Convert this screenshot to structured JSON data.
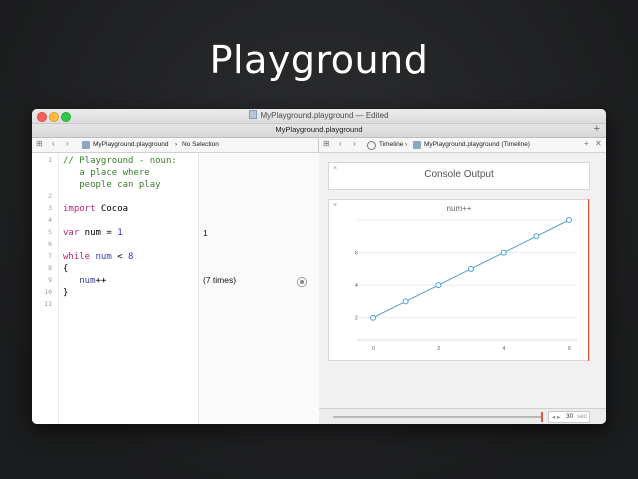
{
  "slide": {
    "title": "Playground"
  },
  "window": {
    "title": "MyPlayground.playground — Edited",
    "tab_label": "MyPlayground.playground",
    "tab_add": "+"
  },
  "editor_jumpbar": {
    "grid_icon": "⊞",
    "back_icon": "‹",
    "forward_icon": "›",
    "file": "MyPlayground.playground",
    "sep": "›",
    "selection": "No Selection"
  },
  "assistant_jumpbar": {
    "grid_icon": "⊞",
    "back_icon": "‹",
    "forward_icon": "›",
    "mode": "Timeline",
    "sep": "›",
    "file": "MyPlayground.playground (Timeline)",
    "add_icon": "+",
    "close_icon": "✕"
  },
  "code": {
    "line_numbers": [
      "1",
      "",
      "",
      "2",
      "3",
      "4",
      "5",
      "6",
      "7",
      "8",
      "9",
      "10",
      "11"
    ],
    "lines": [
      {
        "segments": [
          {
            "t": "// Playground - noun:",
            "c": "cmt"
          }
        ]
      },
      {
        "segments": [
          {
            "t": "   a place where",
            "c": "cmt"
          }
        ]
      },
      {
        "segments": [
          {
            "t": "   people can play",
            "c": "cmt"
          }
        ]
      },
      {
        "segments": []
      },
      {
        "segments": [
          {
            "t": "import",
            "c": "kw"
          },
          {
            "t": " Cocoa",
            "c": ""
          }
        ]
      },
      {
        "segments": []
      },
      {
        "segments": [
          {
            "t": "var",
            "c": "kw"
          },
          {
            "t": " num = ",
            "c": ""
          },
          {
            "t": "1",
            "c": "num"
          }
        ]
      },
      {
        "segments": []
      },
      {
        "segments": [
          {
            "t": "while",
            "c": "kw"
          },
          {
            "t": " ",
            "c": ""
          },
          {
            "t": "num",
            "c": "var"
          },
          {
            "t": " < ",
            "c": ""
          },
          {
            "t": "8",
            "c": "num"
          }
        ]
      },
      {
        "segments": [
          {
            "t": "{",
            "c": ""
          }
        ]
      },
      {
        "segments": [
          {
            "t": "   ",
            "c": ""
          },
          {
            "t": "num",
            "c": "var"
          },
          {
            "t": "++",
            "c": ""
          }
        ]
      },
      {
        "segments": [
          {
            "t": "}",
            "c": ""
          }
        ]
      }
    ]
  },
  "results": {
    "var_result": "1",
    "loop_result": "(7 times)"
  },
  "timeline": {
    "console": {
      "title": "Console Output",
      "close": "×"
    },
    "graph": {
      "close": "×",
      "title": "num++"
    }
  },
  "chart_data": {
    "type": "line",
    "title": "num++",
    "x": [
      0,
      1,
      2,
      3,
      4,
      5,
      6
    ],
    "series": [
      {
        "values": [
          2,
          3,
          4,
          5,
          6,
          7,
          8
        ]
      }
    ],
    "x_ticks": [
      "0",
      "2",
      "4",
      "6"
    ],
    "y_ticks": [
      "2",
      "4",
      "6"
    ],
    "xlim": [
      0,
      6
    ],
    "ylim": [
      1,
      8
    ],
    "grid": "horizontal",
    "line_color": "#4a9fd6"
  },
  "scrubber": {
    "value": "30",
    "unit": "sec",
    "stepper": "◂ ▸"
  },
  "colors": {
    "accent_red": "#e0543e",
    "background": "#1f2021"
  },
  "icons": [
    "grid-icon",
    "back-arrow-icon",
    "forward-arrow-icon",
    "playground-file-icon",
    "timeline-icon",
    "quick-look-icon",
    "close-icon",
    "add-icon"
  ]
}
